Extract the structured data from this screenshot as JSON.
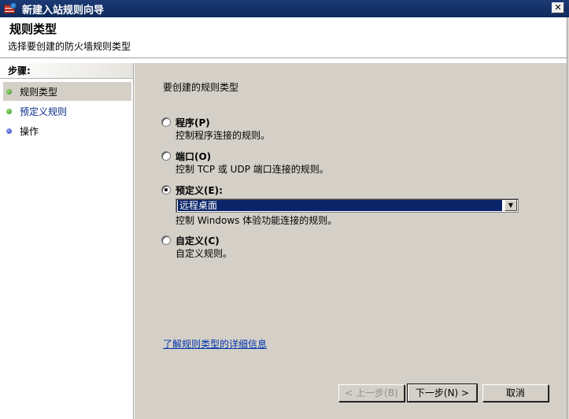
{
  "window": {
    "title": "新建入站规则向导",
    "close": "✕"
  },
  "header": {
    "title": "规则类型",
    "subtitle": "选择要创建的防火墙规则类型"
  },
  "steps": {
    "title": "步骤:",
    "items": [
      {
        "label": "规则类型",
        "state": "current",
        "dot": "green"
      },
      {
        "label": "预定义规则",
        "state": "link",
        "dot": "green"
      },
      {
        "label": "操作",
        "state": "pending",
        "dot": "blue"
      }
    ]
  },
  "main": {
    "prompt": "要创建的规则类型",
    "options": [
      {
        "label": "程序(P)",
        "desc": "控制程序连接的规则。",
        "checked": false
      },
      {
        "label": "端口(O)",
        "desc": "控制 TCP 或 UDP 端口连接的规则。",
        "checked": false
      },
      {
        "label": "预定义(E):",
        "desc": "控制 Windows 体验功能连接的规则。",
        "checked": true
      },
      {
        "label": "自定义(C)",
        "desc": "自定义规则。",
        "checked": false
      }
    ],
    "predefined_select": {
      "value": "远程桌面",
      "arrow": "▼"
    },
    "more_link": "了解规则类型的详细信息"
  },
  "buttons": {
    "back": "< 上一步(B)",
    "next": "下一步(N) >",
    "cancel": "取消"
  },
  "colors": {
    "titlebar": "#0e2a5c",
    "panel": "#d4d0c8",
    "selection": "#0a246a",
    "link": "#0033aa"
  }
}
